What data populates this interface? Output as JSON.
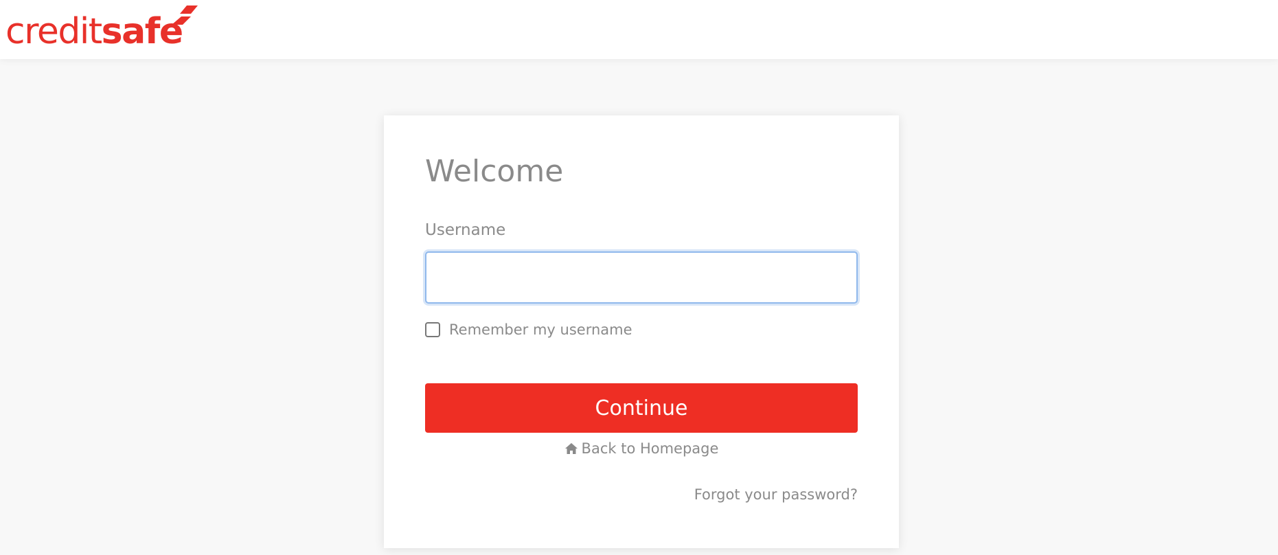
{
  "header": {
    "logo": {
      "text_light": "credit",
      "text_bold": "safe",
      "color": "#e8312a"
    }
  },
  "login": {
    "title": "Welcome",
    "username_label": "Username",
    "username_value": "",
    "remember_label": "Remember my username",
    "remember_checked": false,
    "continue_label": "Continue",
    "back_label": "Back to Homepage",
    "back_icon": "home-icon",
    "forgot_label": "Forgot your password?"
  },
  "colors": {
    "accent": "#ee2e24",
    "text_muted": "#8a8a8a",
    "focus_border": "#8fb8ec"
  }
}
